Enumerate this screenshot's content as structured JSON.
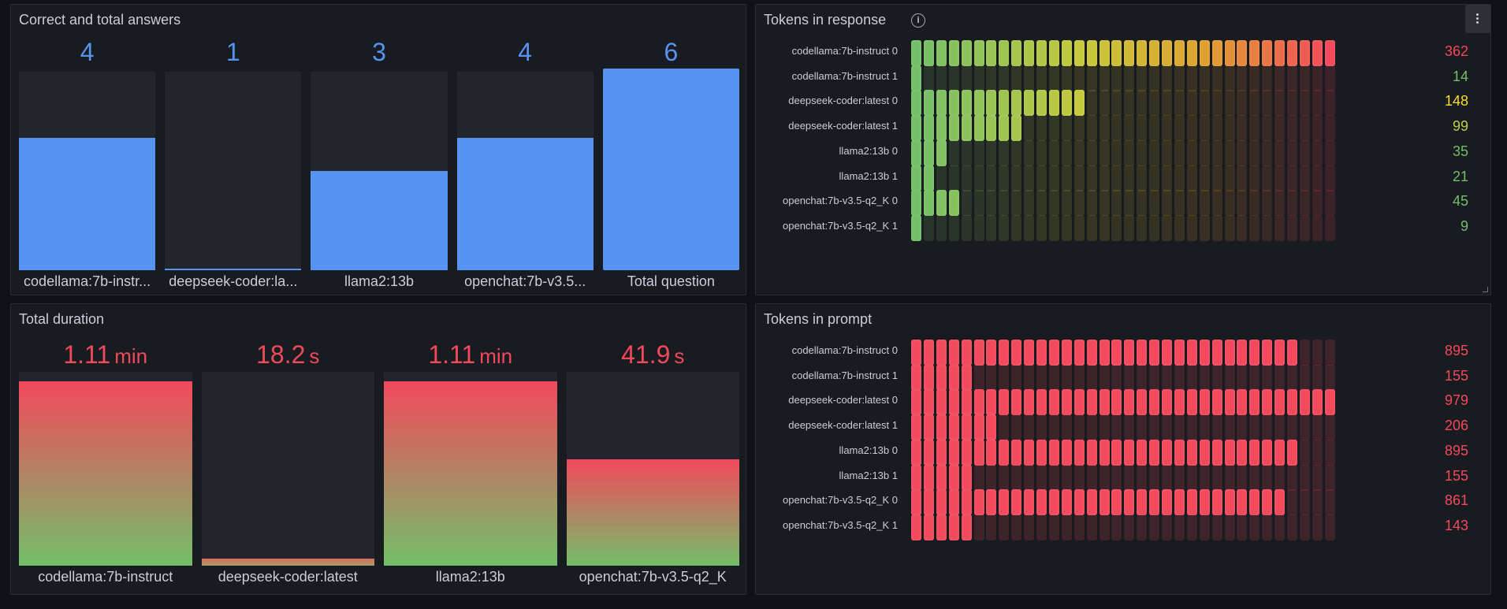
{
  "panels": {
    "correct": {
      "title": "Correct and total answers",
      "max": 6,
      "color": "#5794f2",
      "bars": [
        {
          "label": "codellama:7b-instr...",
          "value": 4,
          "display": "4"
        },
        {
          "label": "deepseek-coder:la...",
          "value": 1,
          "display": "1"
        },
        {
          "label": "llama2:13b",
          "value": 3,
          "display": "3"
        },
        {
          "label": "openchat:7b-v3.5...",
          "value": 4,
          "display": "4"
        },
        {
          "label": "Total question",
          "value": 6,
          "display": "6"
        }
      ]
    },
    "duration": {
      "title": "Total duration",
      "color_top": "#f2495c",
      "color_bottom": "#73bf69",
      "bars": [
        {
          "label": "codellama:7b-instruct",
          "display": "1.11",
          "unit": "min",
          "seconds": 66.6
        },
        {
          "label": "deepseek-coder:latest",
          "display": "18.2",
          "unit": "s",
          "seconds": 18.2
        },
        {
          "label": "llama2:13b",
          "display": "1.11",
          "unit": "min",
          "seconds": 66.6
        },
        {
          "label": "openchat:7b-v3.5-q2_K",
          "display": "41.9",
          "unit": "s",
          "seconds": 41.9
        }
      ]
    },
    "response": {
      "title": "Tokens in response",
      "max": 362,
      "rows": [
        {
          "label": "codellama:7b-instruct 0",
          "value": 362,
          "color": "#f2495c"
        },
        {
          "label": "codellama:7b-instruct 1",
          "value": 14,
          "color": "#73bf69"
        },
        {
          "label": "deepseek-coder:latest 0",
          "value": 148,
          "color": "#fade2a"
        },
        {
          "label": "deepseek-coder:latest 1",
          "value": 99,
          "color": "#b8d14a"
        },
        {
          "label": "llama2:13b 0",
          "value": 35,
          "color": "#73bf69"
        },
        {
          "label": "llama2:13b 1",
          "value": 21,
          "color": "#73bf69"
        },
        {
          "label": "openchat:7b-v3.5-q2_K 0",
          "value": 45,
          "color": "#73bf69"
        },
        {
          "label": "openchat:7b-v3.5-q2_K 1",
          "value": 9,
          "color": "#73bf69"
        }
      ]
    },
    "prompt": {
      "title": "Tokens in prompt",
      "max": 979,
      "rows": [
        {
          "label": "codellama:7b-instruct 0",
          "value": 895
        },
        {
          "label": "codellama:7b-instruct 1",
          "value": 155
        },
        {
          "label": "deepseek-coder:latest 0",
          "value": 979
        },
        {
          "label": "deepseek-coder:latest 1",
          "value": 206
        },
        {
          "label": "llama2:13b 0",
          "value": 895
        },
        {
          "label": "llama2:13b 1",
          "value": 155
        },
        {
          "label": "openchat:7b-v3.5-q2_K 0",
          "value": 861
        },
        {
          "label": "openchat:7b-v3.5-q2_K 1",
          "value": 143
        }
      ],
      "color": "#f2495c"
    }
  },
  "icons": {
    "info": "info-icon",
    "menu": "kebab-menu-icon"
  }
}
